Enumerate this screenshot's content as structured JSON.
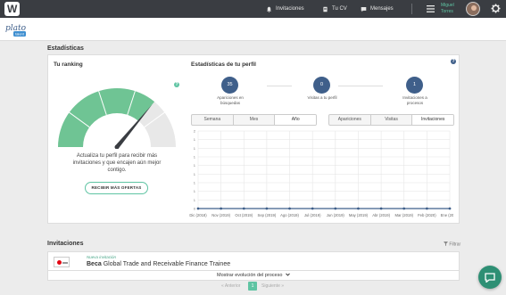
{
  "nav": {
    "logo_letter": "W",
    "items": [
      {
        "label": "Invitaciones",
        "icon": "bell-icon"
      },
      {
        "label": "Tu CV",
        "icon": "document-icon"
      },
      {
        "label": "Mensajes",
        "icon": "chat-icon"
      }
    ],
    "menu_icon": "hamburger-icon",
    "user": {
      "first_name": "Miguel",
      "last_name": "Torres"
    },
    "settings_icon": "gear-icon",
    "accent": "#5fc4a3",
    "bar_color": "#3a3d42"
  },
  "brand": {
    "text": "plato",
    "badge": "talent"
  },
  "estadisticas": {
    "title": "Estadísticas",
    "ranking": {
      "title": "Tu ranking",
      "gauge_level": 0.72,
      "message": "Actualiza tu perfil para recibir más invitaciones y que encajen aún mejor contigo.",
      "button": "RECIBIR MÁS OFERTAS",
      "help": "?"
    },
    "perfil": {
      "title": "Estadísticas de tu perfil",
      "help": "?",
      "stats": [
        {
          "value": "35",
          "label": "Apariciones en búsquedas"
        },
        {
          "value": "0",
          "label": "Visitas a tu perfil"
        },
        {
          "value": "1",
          "label": "Invitaciones a procesos"
        }
      ],
      "period_tabs": [
        "Semana",
        "Mes",
        "Año"
      ],
      "period_active": "Año",
      "metric_tabs": [
        "Apariciones",
        "Visitas",
        "Invitaciones"
      ],
      "metric_active": "Invitaciones"
    }
  },
  "chart_data": {
    "type": "line",
    "title": "",
    "xlabel": "",
    "ylabel": "",
    "categories": [
      "Dic (2018)",
      "Nov (2019)",
      "Oct (2019)",
      "Sep (2019)",
      "Ago (2019)",
      "Jul (2019)",
      "Jun (2019)",
      "May (2019)",
      "Abr (2019)",
      "Mar (2019)",
      "Feb (2020)",
      "Ene (2020)"
    ],
    "series": [
      {
        "values": [
          0,
          0,
          0,
          0,
          0,
          0,
          0,
          0,
          0,
          0,
          0,
          0
        ]
      }
    ],
    "yticks": [
      "0",
      "1",
      "1",
      "1",
      "1",
      "1",
      "1",
      "1",
      "1",
      "2"
    ],
    "ylim": [
      0,
      2
    ],
    "grid": true,
    "line_color": "#3f5f8a"
  },
  "invitaciones": {
    "title": "Invitaciones",
    "filter": "Filtrar",
    "items": [
      {
        "tag": "Nueva invitación",
        "company": "Beca",
        "position": "Global Trade and Receivable Finance Trainee"
      }
    ],
    "show_more": "Mostrar evolución del proceso",
    "pager": {
      "prev": "« Anterior",
      "page": "1",
      "next": "Siguiente »"
    }
  }
}
